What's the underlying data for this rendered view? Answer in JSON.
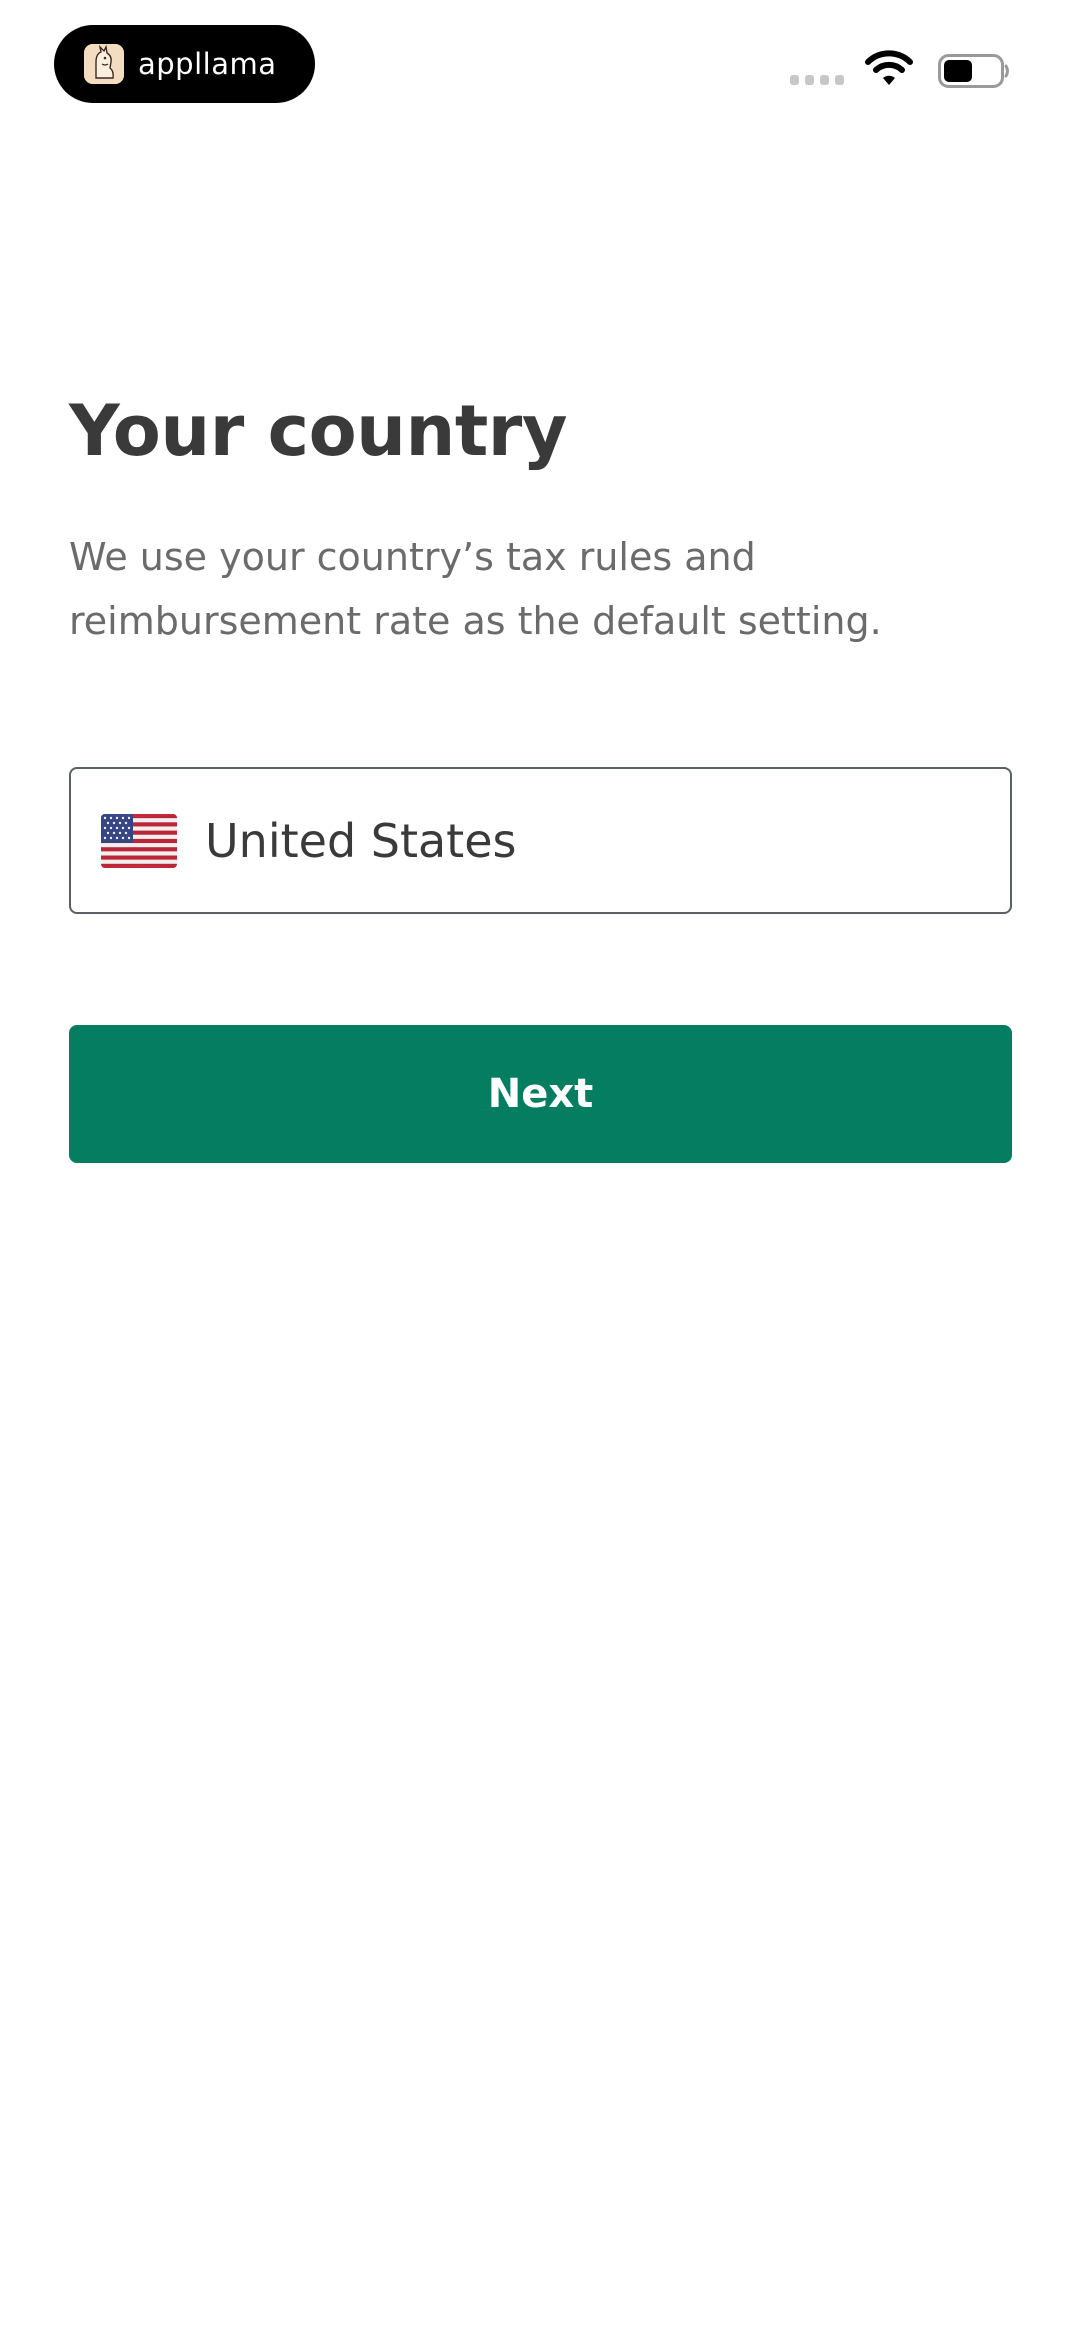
{
  "status_bar": {
    "app_name": "appllama",
    "app_icon": "llama-logo-icon",
    "signal_icon": "signal-icon",
    "wifi_icon": "wifi-icon",
    "battery_icon": "battery-icon",
    "battery_level": 0.5
  },
  "page": {
    "title": "Your country",
    "description": "We use your country’s tax rules and reimbursement rate as the default setting."
  },
  "country_selector": {
    "flag_icon": "us-flag-icon",
    "value": "United States"
  },
  "actions": {
    "next_label": "Next"
  },
  "colors": {
    "primary": "#057d61",
    "title_text": "#3a3a3a",
    "body_text": "#6b6b6b",
    "field_border": "#5a6166",
    "background": "#ffffff"
  }
}
